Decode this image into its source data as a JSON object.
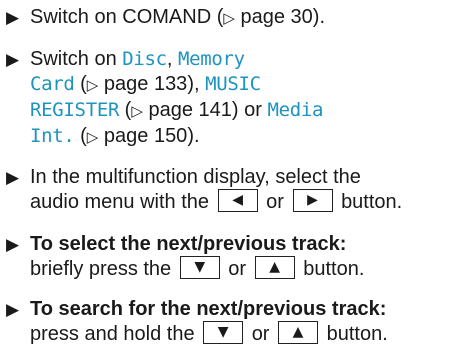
{
  "bullet_glyph": "▶",
  "ref_glyph": "▷",
  "steps": [
    {
      "a": "Switch on COMAND (",
      "ref": "page 30",
      "b": ")."
    },
    {
      "a": "Switch on ",
      "disc": "Disc",
      "sep1": ", ",
      "memory1": "Memory",
      "memory2": "Card",
      "r1open": " (",
      "ref1": "page 133",
      "r1close": "), ",
      "music1": "MUSIC",
      "music2": "REGISTER",
      "r2open": " (",
      "ref2": "page 141",
      "r2close": ") or ",
      "media1": "Media",
      "media2": "Int.",
      "r3open": " (",
      "ref3": "page 150",
      "r3close": ")."
    },
    {
      "line1": "In the multifunction display, select the",
      "line2a": "audio menu with the",
      "key1": "◀",
      "or": "or",
      "key2": "▶",
      "line2b": "button."
    },
    {
      "bold": "To select the next/previous track:",
      "line2a": "briefly press the",
      "key1": "▼",
      "or": "or",
      "key2": "▲",
      "line2b": "button."
    },
    {
      "bold": "To search for the next/previous track:",
      "line2a": "press and hold the",
      "key1": "▼",
      "or": "or",
      "key2": "▲",
      "line2b": "button."
    }
  ]
}
